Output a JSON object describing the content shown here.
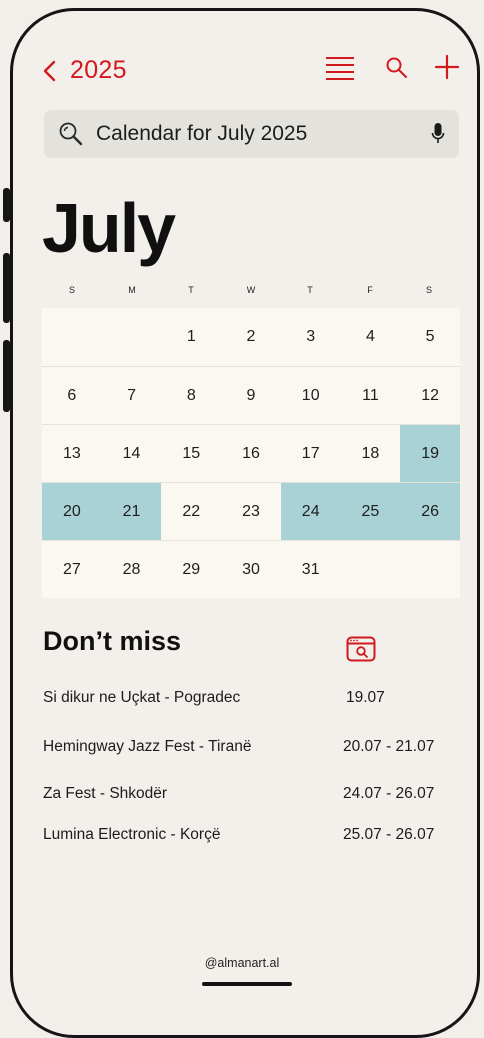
{
  "header": {
    "back_label": "2025"
  },
  "search": {
    "text": "Calendar for July 2025"
  },
  "calendar": {
    "month": "July",
    "weekdays": [
      "S",
      "M",
      "T",
      "W",
      "T",
      "F",
      "S"
    ],
    "weeks": [
      [
        "",
        "",
        "1",
        "2",
        "3",
        "4",
        "5"
      ],
      [
        "6",
        "7",
        "8",
        "9",
        "10",
        "11",
        "12"
      ],
      [
        "13",
        "14",
        "15",
        "16",
        "17",
        "18",
        "19"
      ],
      [
        "20",
        "21",
        "22",
        "23",
        "24",
        "25",
        "26"
      ],
      [
        "27",
        "28",
        "29",
        "30",
        "31",
        "",
        ""
      ]
    ],
    "highlighted_days": [
      "19",
      "20",
      "21",
      "24",
      "25",
      "26"
    ],
    "highlight_color": "#a9d2d7"
  },
  "dont_miss": {
    "title": "Don’t miss",
    "events": [
      {
        "name": "Si dikur ne Uçkat - Pogradec",
        "date": "19.07"
      },
      {
        "name": "Hemingway Jazz Fest - Tiranë",
        "date": "20.07 - 21.07"
      },
      {
        "name": "Za Fest - Shkodër",
        "date": "24.07 - 26.07"
      },
      {
        "name": "Lumina Electronic - Korçë",
        "date": "25.07 - 26.07"
      }
    ]
  },
  "footer": {
    "handle": "@almanart.al"
  },
  "colors": {
    "accent": "#d2191e",
    "background": "#f3f0ec",
    "grid_background": "#fbf8f1"
  },
  "icons": [
    "chevron-left-icon",
    "list-icon",
    "search-icon",
    "plus-icon",
    "magnifier-icon",
    "microphone-icon",
    "browser-search-icon"
  ]
}
